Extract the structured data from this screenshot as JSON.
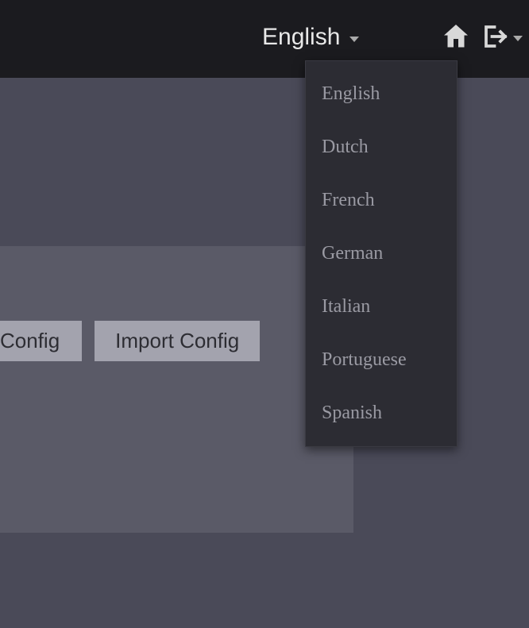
{
  "topbar": {
    "language_label": "English"
  },
  "language_menu": {
    "items": [
      "English",
      "Dutch",
      "French",
      "German",
      "Italian",
      "Portuguese",
      "Spanish"
    ]
  },
  "buttons": {
    "config_partial": "Config",
    "import_config": "Import Config"
  }
}
